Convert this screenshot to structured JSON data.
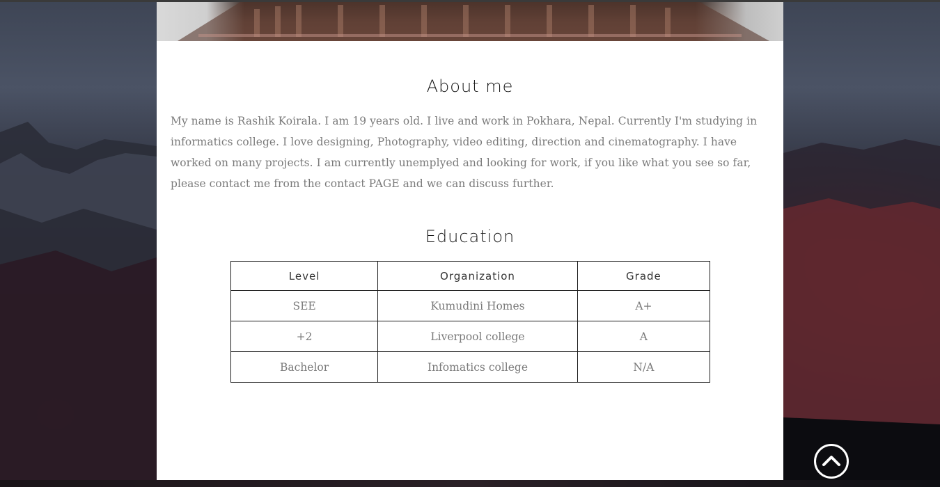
{
  "about": {
    "title": "About me",
    "text": "My name is Rashik Koirala. I am 19 years old. I live and work in Pokhara, Nepal. Currently I'm studying in informatics college. I love designing, Photography, video editing, direction and cinematography. I have worked on many projects. I am currently unemplyed and looking for work, if you like what you see so far, please contact me from the contact PAGE and we can discuss further."
  },
  "education": {
    "title": "Education",
    "headers": [
      "Level",
      "Organization",
      "Grade"
    ],
    "rows": [
      [
        "SEE",
        "Kumudini Homes",
        "A+"
      ],
      [
        "+2",
        "Liverpool college",
        "A"
      ],
      [
        "Bachelor",
        "Infomatics college",
        "N/A"
      ]
    ]
  },
  "icons": {
    "scroll_top": "chevron-up-circle-icon"
  },
  "colors": {
    "card": "#ffffff",
    "heading": "#1a1a1a",
    "body_text": "#7a7a7a",
    "table_border": "#1a1a1a"
  }
}
